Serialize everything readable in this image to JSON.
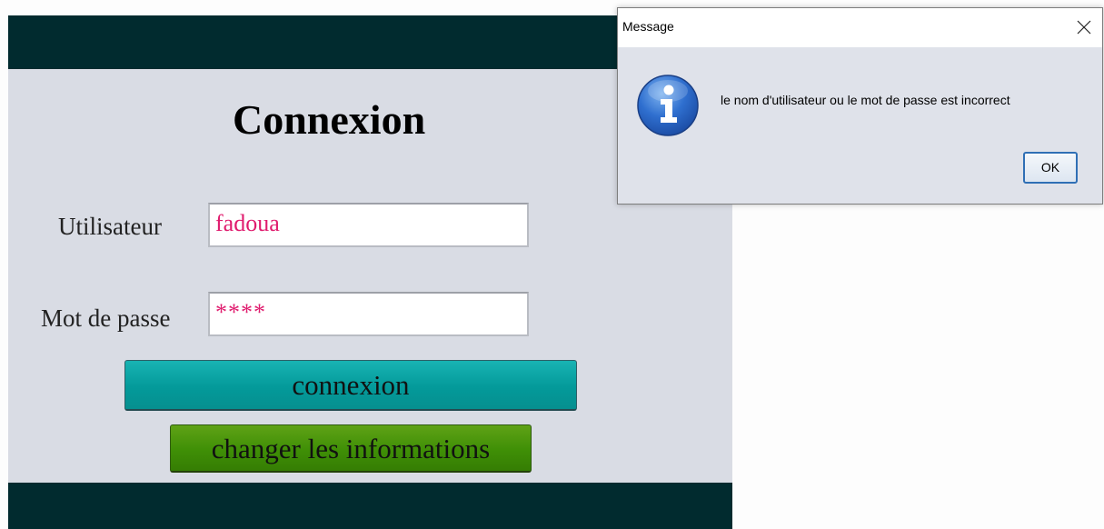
{
  "login": {
    "title": "Connexion",
    "username_label": "Utilisateur",
    "username_value": "fadoua",
    "password_label": "Mot de passe",
    "password_value": "****",
    "login_button_label": "connexion",
    "change_button_label": "changer les informations"
  },
  "dialog": {
    "title": "Message",
    "message": "le nom d'utilisateur ou le mot de passe est incorrect",
    "ok_label": "OK",
    "icon": "info-icon",
    "close_icon": "close-icon"
  },
  "colors": {
    "bar": "#012b2f",
    "panel": "#d9dce4",
    "input_text": "#e01c6e",
    "login_button": "#049a9a",
    "change_button": "#3f8f06",
    "dialog_bg": "#dfe2ea"
  }
}
